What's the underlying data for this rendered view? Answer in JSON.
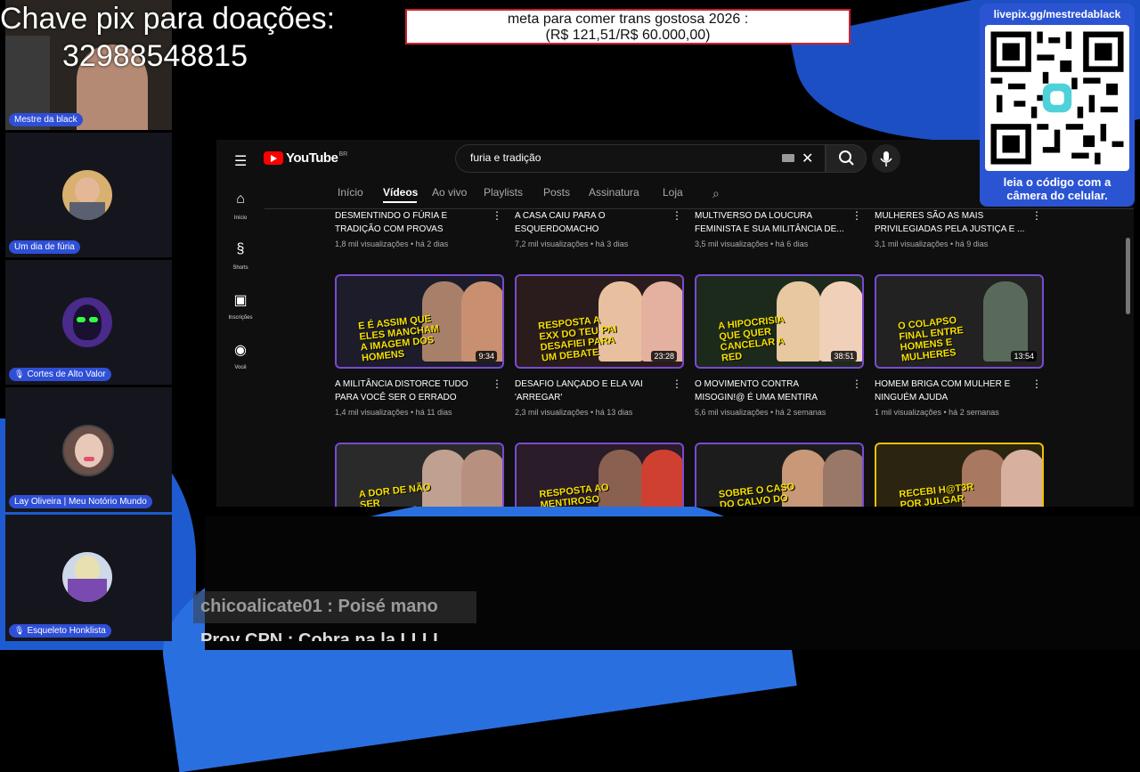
{
  "donation": {
    "title": "Chave pix para doações:",
    "key": "32988548815"
  },
  "goal": {
    "line1": "meta para comer trans gostosa 2026 :",
    "line2": "(R$ 121,51/R$ 60.000,00)"
  },
  "participants": [
    {
      "name": "Mestre da black",
      "mic": false
    },
    {
      "name": "Um dia de fúria",
      "mic": false
    },
    {
      "name": "Cortes de Alto Valor",
      "mic": true
    },
    {
      "name": "Lay Oliveira | Meu Notório Mundo",
      "mic": false
    },
    {
      "name": "Esqueleto Honklista",
      "mic": true
    }
  ],
  "youtube": {
    "logo": "YouTube",
    "region": "BR",
    "search_value": "furia e tradição",
    "rail": [
      {
        "label": "Início",
        "icon": "home-icon"
      },
      {
        "label": "Shorts",
        "icon": "shorts-icon"
      },
      {
        "label": "Inscrições",
        "icon": "subscriptions-icon"
      },
      {
        "label": "Você",
        "icon": "you-icon"
      }
    ],
    "tabs": [
      "Início",
      "Vídeos",
      "Ao vivo",
      "Playlists",
      "Posts",
      "Assinatura",
      "Loja"
    ],
    "active_tab": "Vídeos",
    "top_row": [
      {
        "title": "DESMENTINDO O FÚRIA E TRADIÇÃO COM PROVAS",
        "meta": "1,8 mil visualizações • há 2 dias"
      },
      {
        "title": "A CASA CAIU PARA O ESQUERDOMACHO",
        "meta": "7,2 mil visualizações • há 3 dias"
      },
      {
        "title": "MULTIVERSO DA LOUCURA FEMINISTA e sua MILITÂNCIA DE...",
        "meta": "3,5 mil visualizações • há 6 dias"
      },
      {
        "title": "MULHERES SÃO AS MAIS PRIVILEGIADAS PELA JUSTIÇA e ...",
        "meta": "3,1 mil visualizações • há 9 dias"
      }
    ],
    "middle_row": [
      {
        "thumb_text": "E É ASSIM QUE ELES MANCHAM A IMAGEM DOS HOMENS",
        "duration": "9:34",
        "title": "A MILITÂNCIA DISTORCE TUDO PARA VOCÊ SER O ERRADO",
        "meta": "1,4 mil visualizações • há 11 dias"
      },
      {
        "thumb_text": "RESPOSTA A EXX DO TEU PAI DESAFIEI PARA UM DEBATE",
        "duration": "23:28",
        "title": "DESAFIO LANÇADO e ELA VAI 'ARREGAR'",
        "meta": "2,3 mil visualizações • há 13 dias"
      },
      {
        "thumb_text": "A HIPOCRISIA QUE QUER CANCELAR A RED",
        "duration": "38:51",
        "title": "O movimento CONTRA MISOGIN!@ É UMA MENTIRA",
        "meta": "5,6 mil visualizações • há 2 semanas"
      },
      {
        "thumb_text": "O COLAPSO FINAL ENTRE HOMENS E MULHERES",
        "duration": "13:54",
        "title": "HOMEM BRIGA COM MULHER E NINGUÉM AJUDA",
        "meta": "1 mil visualizações • há 2 semanas"
      }
    ],
    "bottom_row": [
      {
        "thumb_text": "A DOR DE NÃO SER ESCOLHIDA"
      },
      {
        "thumb_text": "RESPOSTA AO MENTIROSO"
      },
      {
        "thumb_text": "SOBRE O CASO DO CALVO DO CAMPARI"
      },
      {
        "thumb_text": "RECEBI H@T3R POR JULGAR"
      }
    ]
  },
  "qr": {
    "url": "livepix.gg/mestredablack",
    "caption_line1": "leia o código com a",
    "caption_line2": "câmera do celular."
  },
  "chat": {
    "message1": "chicoalicate01 : Poisé mano",
    "message2": "Prov CPN : Cobra na la LLLL"
  }
}
